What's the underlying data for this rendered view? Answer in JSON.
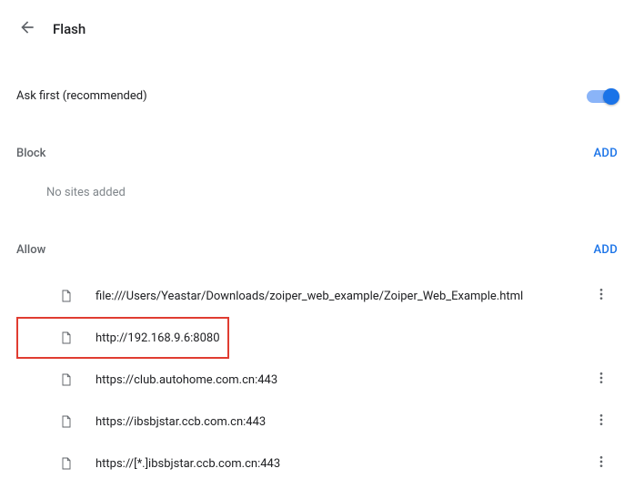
{
  "header": {
    "title": "Flash"
  },
  "askFirst": {
    "label": "Ask first (recommended)",
    "enabled": true
  },
  "block": {
    "heading": "Block",
    "addLabel": "ADD",
    "emptyText": "No sites added",
    "sites": []
  },
  "allow": {
    "heading": "Allow",
    "addLabel": "ADD",
    "sites": [
      {
        "url": "file:///Users/Yeastar/Downloads/zoiper_web_example/Zoiper_Web_Example.html",
        "highlighted": false
      },
      {
        "url": "http://192.168.9.6:8080",
        "highlighted": true
      },
      {
        "url": "https://club.autohome.com.cn:443",
        "highlighted": false
      },
      {
        "url": "https://ibsbjstar.ccb.com.cn:443",
        "highlighted": false
      },
      {
        "url": "https://[*.]ibsbjstar.ccb.com.cn:443",
        "highlighted": false
      }
    ]
  }
}
